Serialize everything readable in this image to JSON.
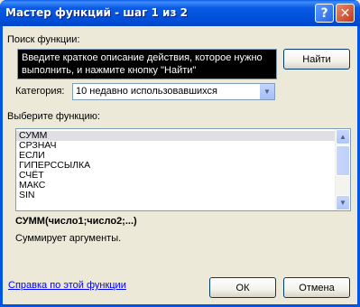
{
  "window": {
    "title": "Мастер функций - шаг 1 из 2",
    "help_glyph": "?",
    "close_glyph": "✕"
  },
  "search": {
    "label": "Поиск функции:",
    "value": "Введите краткое описание действия, которое нужно выполнить, и нажмите кнопку \"Найти\"",
    "find_button": "Найти"
  },
  "category": {
    "label": "Категория:",
    "selected": "10 недавно использовавшихся",
    "arrow_glyph": "▼"
  },
  "functions": {
    "label": "Выберите функцию:",
    "items": [
      "СУММ",
      "СРЗНАЧ",
      "ЕСЛИ",
      "ГИПЕРССЫЛКА",
      "СЧЁТ",
      "МАКС",
      "SIN"
    ],
    "selected_index": 0,
    "scroll_up_glyph": "▲",
    "scroll_down_glyph": "▼"
  },
  "details": {
    "signature": "СУММ(число1;число2;...)",
    "description": "Суммирует аргументы."
  },
  "footer": {
    "help_link": "Справка по этой функции",
    "ok": "ОК",
    "cancel": "Отмена"
  }
}
